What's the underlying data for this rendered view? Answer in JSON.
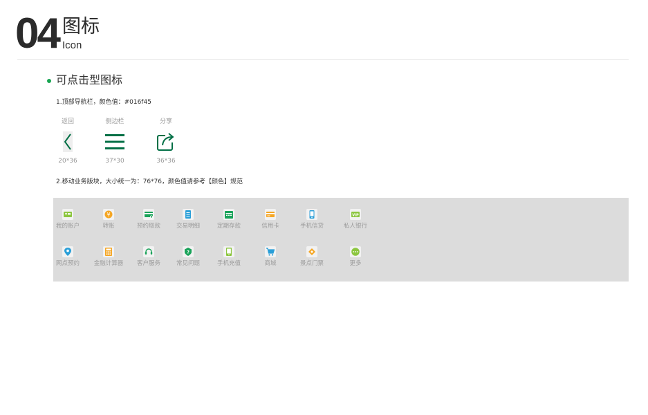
{
  "header": {
    "number": "04",
    "title_cn": "图标",
    "title_en": "Icon"
  },
  "section": {
    "title": "可点击型图标"
  },
  "nav": {
    "desc": "1.顶部导航栏，颜色值：#016f45",
    "color": "#016f45",
    "items": [
      {
        "label": "返回",
        "size": "20*36",
        "icon": "back-arrow-icon"
      },
      {
        "label": "侧边栏",
        "size": "37*30",
        "icon": "menu-icon"
      },
      {
        "label": "分享",
        "size": "36*36",
        "icon": "share-icon"
      }
    ]
  },
  "biz": {
    "desc": "2.移动业务版块，大小统一为：76*76，颜色值请参考【颜色】规范",
    "rows": [
      [
        {
          "label": "我的账户",
          "icon": "account-card-icon",
          "color": "#8cc63f"
        },
        {
          "label": "转账",
          "icon": "transfer-yen-icon",
          "color": "#f5a623"
        },
        {
          "label": "预约取款",
          "icon": "withdraw-card-icon",
          "color": "#1aa35a"
        },
        {
          "label": "交易明细",
          "icon": "transaction-list-icon",
          "color": "#2a9fd8"
        },
        {
          "label": "定期存款",
          "icon": "deposit-calendar-icon",
          "color": "#1aa35a"
        },
        {
          "label": "信用卡",
          "icon": "credit-card-icon",
          "color": "#f5a623"
        },
        {
          "label": "手机信贷",
          "icon": "phone-loan-icon",
          "color": "#2a9fd8"
        },
        {
          "label": "私人银行",
          "icon": "vip-icon",
          "color": "#8cc63f"
        }
      ],
      [
        {
          "label": "网点预约",
          "icon": "location-pin-icon",
          "color": "#2a9fd8"
        },
        {
          "label": "金融计算器",
          "icon": "calculator-icon",
          "color": "#f5a623"
        },
        {
          "label": "客户服务",
          "icon": "headset-icon",
          "color": "#1aa35a"
        },
        {
          "label": "常见问题",
          "icon": "question-icon",
          "color": "#1aa35a"
        },
        {
          "label": "手机充值",
          "icon": "phone-topup-icon",
          "color": "#8cc63f"
        },
        {
          "label": "商城",
          "icon": "shopping-cart-icon",
          "color": "#2a9fd8"
        },
        {
          "label": "景点门票",
          "icon": "ticket-icon",
          "color": "#f5a623"
        },
        {
          "label": "更多",
          "icon": "more-dots-icon",
          "color": "#8cc63f"
        }
      ]
    ]
  }
}
